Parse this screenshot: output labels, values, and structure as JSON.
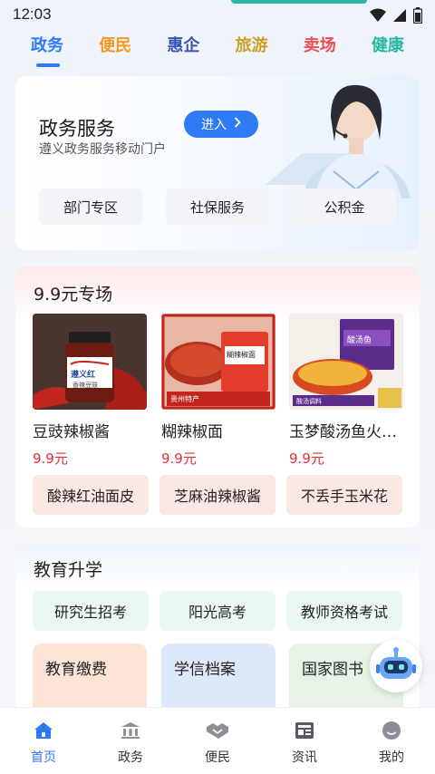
{
  "status_bar": {
    "time": "12:03"
  },
  "tabs": [
    {
      "label": "政务",
      "color": "#2f7bf5",
      "active": true
    },
    {
      "label": "便民",
      "color": "#f29a1f"
    },
    {
      "label": "惠企",
      "color": "#3b55b0"
    },
    {
      "label": "旅游",
      "color": "#c8a126"
    },
    {
      "label": "卖场",
      "color": "#ee4d54"
    },
    {
      "label": "健康",
      "color": "#25b8a6"
    }
  ],
  "service": {
    "title": "政务服务",
    "subtitle": "遵义政务服务移动门户",
    "enter_label": "进入",
    "buttons": [
      "部门专区",
      "社保服务",
      "公积金"
    ]
  },
  "deals": {
    "title": "9.9元专场",
    "products": [
      {
        "name": "豆豉辣椒酱",
        "price": "9.9元",
        "image_label": "遵义红",
        "image_sub": "香辣豆豉"
      },
      {
        "name": "糊辣椒面",
        "price": "9.9元",
        "image_label": "糊辣椒面",
        "image_sub": "贵州特产"
      },
      {
        "name": "玉梦酸汤鱼火锅底料",
        "price": "9.9元",
        "image_label": "酸汤鱼",
        "image_sub": "酸汤调料"
      }
    ],
    "tags": [
      "酸辣红油面皮",
      "芝麻油辣椒酱",
      "不丢手玉米花"
    ]
  },
  "education": {
    "title": "教育升学",
    "chips": [
      "研究生招考",
      "阳光高考",
      "教师资格考试"
    ],
    "tiles": [
      {
        "label": "教育缴费",
        "bg": "#fde4d6"
      },
      {
        "label": "学信档案",
        "bg": "#dde9fb"
      },
      {
        "label": "国家图书",
        "bg": "#e6f3e6"
      }
    ]
  },
  "bottom_nav": [
    {
      "label": "首页",
      "icon": "home-icon",
      "active": true
    },
    {
      "label": "政务",
      "icon": "government-icon"
    },
    {
      "label": "便民",
      "icon": "handshake-icon"
    },
    {
      "label": "资讯",
      "icon": "news-icon"
    },
    {
      "label": "我的",
      "icon": "profile-icon"
    }
  ],
  "colors": {
    "accent": "#2f7bf5",
    "price": "#e0303a"
  }
}
